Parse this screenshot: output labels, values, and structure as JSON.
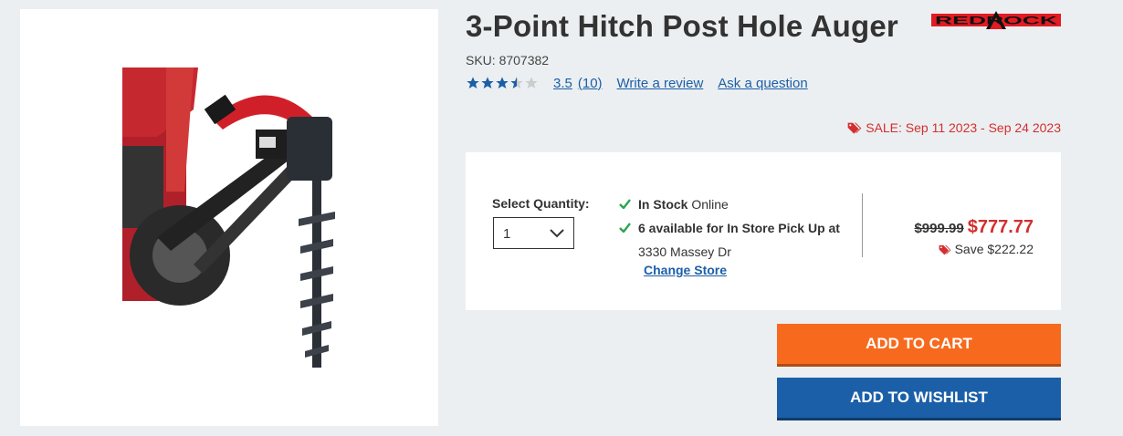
{
  "product": {
    "title": "3-Point Hitch Post Hole Auger",
    "brand_logo_text": "REDROCK",
    "sku_text": "SKU: 8707382",
    "image_icon": "auger-product-photo"
  },
  "rating": {
    "stars": 3.5,
    "score": "3.5",
    "count": "(10)",
    "write_review": "Write a review",
    "ask_question": "Ask a question"
  },
  "sale": {
    "label": "SALE: Sep 11 2023 - Sep 24 2023",
    "icon": "tags-icon"
  },
  "quantity": {
    "label": "Select Quantity:",
    "selected": "1"
  },
  "availability": {
    "in_stock_bold": "In Stock",
    "in_stock_rest": " Online",
    "pickup_bold": "6 available for In Store Pick Up at",
    "store_address": "3330 Massey Dr",
    "change_store": "Change Store"
  },
  "pricing": {
    "old_price": "$999.99",
    "new_price": "$777.77",
    "save_text": "Save $222.22"
  },
  "actions": {
    "add_to_cart": "ADD TO CART",
    "add_to_wishlist": "ADD TO WISHLIST"
  },
  "colors": {
    "accent_orange": "#f76a1d",
    "accent_blue": "#1b5fa8",
    "sale_red": "#d32f2f",
    "brand_red": "#e31b23"
  }
}
